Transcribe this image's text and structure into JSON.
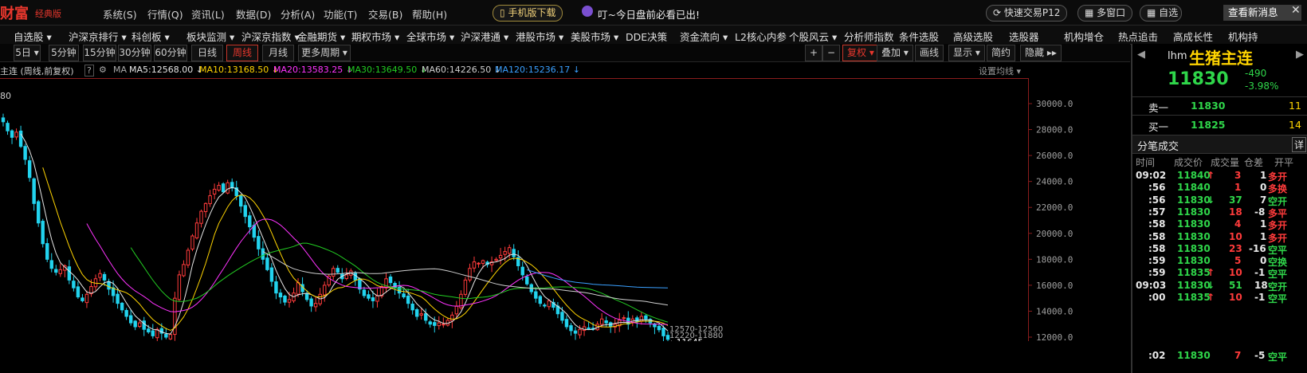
{
  "titlebar": {
    "brand": "财富",
    "edition": "经典版",
    "menus": [
      "系统(S)",
      "行情(Q)",
      "资讯(L)",
      "数据(D)",
      "分析(A)",
      "功能(T)",
      "交易(B)",
      "帮助(H)"
    ],
    "mobile_download": "手机版下载",
    "notice": "叮~今日盘前必看已出!",
    "quick_trade": "快速交易P12",
    "multi_window": "多窗口",
    "self_select": "自选",
    "new_message": "查看新消息",
    "close": "✕"
  },
  "navbar": [
    "自选股 ▾",
    "沪深京排行 ▾",
    "科创板 ▾",
    "板块监测 ▾",
    "沪深京指数 ▾",
    "金融期货 ▾",
    "期权市场 ▾",
    "全球市场 ▾",
    "沪深港通 ▾",
    "港股市场 ▾",
    "美股市场 ▾",
    "DDE决策",
    "资金流向 ▾",
    "L2核心内参",
    "个股风云 ▾",
    "分析师指数",
    "条件选股",
    "高级选股",
    "选股器",
    "机构增仓",
    "热点追击",
    "高成长性",
    "机构持"
  ],
  "periods": [
    "5日 ▾",
    "5分钟",
    "15分钟",
    "30分钟",
    "60分钟",
    "日线",
    "周线",
    "月线",
    "更多周期 ▾"
  ],
  "active_period": "周线",
  "right_tools": {
    "plus": "+",
    "minus": "−",
    "fuquan": "复权 ▾",
    "overlay": "叠加 ▾",
    "draw": "画线",
    "display": "显示 ▾",
    "simple": "简约",
    "hide": "隐藏 ▸▸"
  },
  "ma_bar": {
    "title": "主连 (周线,前复权)",
    "help": "?",
    "label": "MA",
    "ma5": "MA5:12568.00 ↓",
    "ma10": "MA10:13168.50 ↓",
    "ma20": "MA20:13583.25 ↓",
    "ma30": "MA30:13649.50 ↓",
    "ma60": "MA60:14226.50 ↓",
    "ma120": "MA120:15236.17 ↓",
    "settings": "设置均线 ▾"
  },
  "chart_data": {
    "type": "candlestick",
    "period": "weekly",
    "ylim": [
      11000,
      31000
    ],
    "y_ticks": [
      30000.0,
      28000.0,
      26000.0,
      24000.0,
      22000.0,
      20000.0,
      18000.0,
      16000.0,
      14000.0,
      12000.0
    ],
    "y_tick_labels": [
      "30000.0",
      "28000.0",
      "26000.0",
      "24000.0",
      "22000.0",
      "20000.0",
      "18000.0",
      "16000.0",
      "14000.0",
      "12000.0"
    ],
    "top_left_label": "80",
    "last_price_label": "←11645",
    "last_price": 11645,
    "overlay_labels": [
      "12570-12560",
      "12220-11880"
    ],
    "close": [
      28600,
      27900,
      27400,
      27800,
      26700,
      25700,
      24300,
      22300,
      20800,
      19200,
      18000,
      17300,
      17000,
      17200,
      17500,
      16400,
      15800,
      15100,
      14800,
      15300,
      15900,
      16500,
      16900,
      16400,
      15700,
      15200,
      14600,
      14100,
      13600,
      13100,
      12800,
      13100,
      12600,
      12400,
      12100,
      12600,
      12300,
      12000,
      12200,
      15000,
      16800,
      17600,
      18700,
      19800,
      20800,
      21700,
      22300,
      22900,
      23400,
      23700,
      23200,
      23900,
      23500,
      22900,
      22100,
      21300,
      20500,
      19700,
      18800,
      18000,
      17200,
      16300,
      15400,
      15100,
      14700,
      14900,
      15400,
      16200,
      15500,
      14900,
      14400,
      14600,
      15300,
      16000,
      16700,
      17300,
      17000,
      16500,
      16800,
      17100,
      16400,
      15700,
      15200,
      15000,
      14800,
      15200,
      15900,
      16500,
      16200,
      15800,
      15400,
      15100,
      14600,
      14100,
      13600,
      13800,
      13300,
      13000,
      12900,
      13100,
      13000,
      13300,
      13700,
      14400,
      15300,
      16400,
      17300,
      17800,
      17700,
      17900,
      17600,
      17800,
      18000,
      18300,
      18600,
      18900,
      18200,
      17500,
      16800,
      16100,
      15500,
      15000,
      14600,
      14400,
      14800,
      14300,
      13800,
      13300,
      12800,
      12500,
      12300,
      12600,
      12800,
      12700,
      12600,
      13000,
      13400,
      13100,
      12800,
      13000,
      13300,
      13500,
      13000,
      13400,
      13200,
      13600,
      13400,
      13100,
      12800,
      12568,
      12100,
      11830
    ]
  },
  "right_panel": {
    "code": "lhm",
    "name": "生猪主连",
    "price": "11830",
    "change": "-490",
    "change_pct": "-3.98%",
    "sell1_label": "卖一",
    "sell1_price": "11830",
    "sell1_vol": "11",
    "buy1_label": "买一",
    "buy1_price": "11825",
    "buy1_vol": "14",
    "ticks_title": "分笔成交",
    "ticks_detail": "详",
    "headers": [
      "时间",
      "成交价",
      "成交量",
      "仓差",
      "开平"
    ],
    "ticks": [
      {
        "time": "09:02",
        "price": "11840",
        "arrow": "↑",
        "vol": "3",
        "oi": "1",
        "type": "多开"
      },
      {
        "time": ":56",
        "price": "11840",
        "arrow": "",
        "vol": "1",
        "oi": "0",
        "type": "多换"
      },
      {
        "time": ":56",
        "price": "11830",
        "arrow": "↓",
        "vol": "37",
        "oi": "7",
        "type": "空开"
      },
      {
        "time": ":57",
        "price": "11830",
        "arrow": "",
        "vol": "18",
        "oi": "-8",
        "type": "多平"
      },
      {
        "time": ":58",
        "price": "11830",
        "arrow": "",
        "vol": "4",
        "oi": "1",
        "type": "多开"
      },
      {
        "time": ":58",
        "price": "11830",
        "arrow": "",
        "vol": "10",
        "oi": "1",
        "type": "多开"
      },
      {
        "time": ":58",
        "price": "11830",
        "arrow": "",
        "vol": "23",
        "oi": "-16",
        "type": "空平"
      },
      {
        "time": ":59",
        "price": "11830",
        "arrow": "",
        "vol": "5",
        "oi": "0",
        "type": "空换"
      },
      {
        "time": ":59",
        "price": "11835",
        "arrow": "↑",
        "vol": "10",
        "oi": "-1",
        "type": "空平"
      },
      {
        "time": "09:03",
        "price": "11830",
        "arrow": "↓",
        "vol": "51",
        "oi": "18",
        "type": "空开"
      },
      {
        "time": ":00",
        "price": "11835",
        "arrow": "↑",
        "vol": "10",
        "oi": "-1",
        "type": "空平"
      },
      {
        "time": ":02",
        "price": "11830",
        "arrow": "",
        "vol": "7",
        "oi": "-5",
        "type": "空平"
      }
    ]
  },
  "colors": {
    "up": "#ff3b3b",
    "down": "#22d3ee",
    "ma5": "#e6e6e6",
    "ma10": "#ffd400",
    "ma20": "#ff33ff",
    "ma30": "#22cc22",
    "ma60": "#cfcfcf",
    "ma120": "#3aa0ff",
    "accent": "#e8372d"
  }
}
